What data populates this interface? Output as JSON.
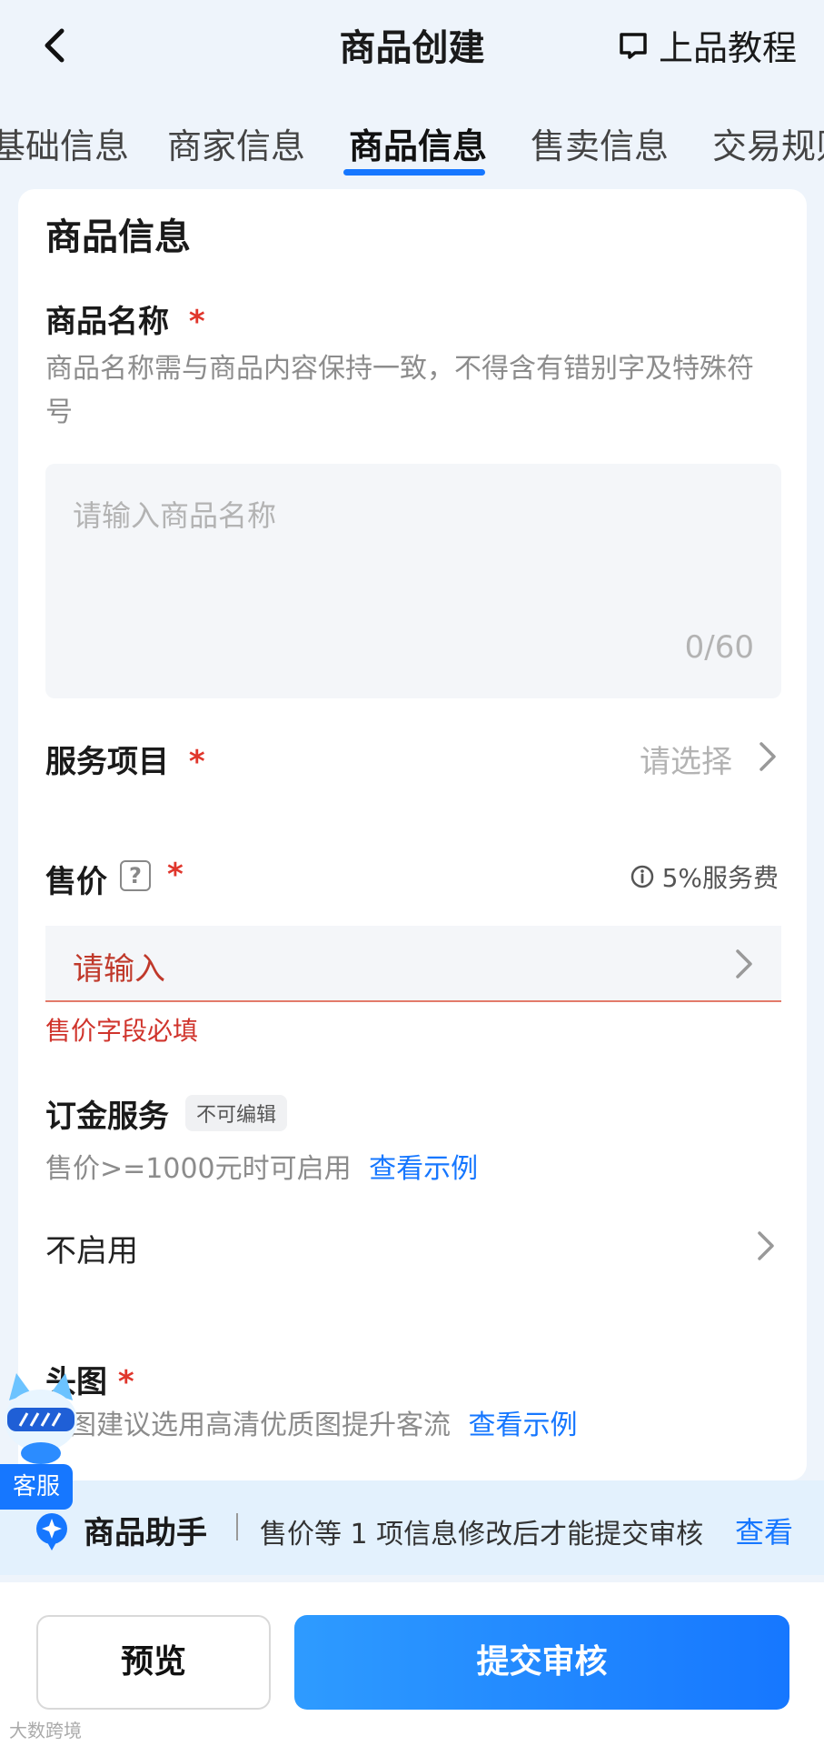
{
  "header": {
    "title": "商品创建",
    "tutorial_label": "上品教程"
  },
  "tabs": [
    {
      "label": "基础信息"
    },
    {
      "label": "商家信息"
    },
    {
      "label": "商品信息",
      "active": true
    },
    {
      "label": "售卖信息"
    },
    {
      "label": "交易规则"
    }
  ],
  "form": {
    "section_title": "商品信息",
    "product_name": {
      "label": "商品名称",
      "required_mark": "*",
      "hint": "商品名称需与商品内容保持一致，不得含有错别字及特殊符号",
      "placeholder": "请输入商品名称",
      "count": "0/60"
    },
    "service_item": {
      "label": "服务项目",
      "required_mark": "*",
      "value": "请选择"
    },
    "price": {
      "label": "售价",
      "help_icon": "?",
      "required_mark": "*",
      "fee_text": "5%服务费",
      "placeholder": "请输入",
      "error": "售价字段必填"
    },
    "deposit": {
      "label": "订金服务",
      "badge": "不可编辑",
      "hint": "售价>=1000元时可启用",
      "example_link": "查看示例",
      "value": "不启用"
    },
    "head_image": {
      "label": "头图",
      "required_mark": "*",
      "hint": "图建议选用高清优质图提升客流",
      "example_link": "查看示例"
    }
  },
  "assistant": {
    "title": "商品助手",
    "message": "售价等 1 项信息修改后才能提交审核",
    "link": "查看"
  },
  "customer_service": {
    "label": "客服"
  },
  "footer": {
    "preview_label": "预览",
    "submit_label": "提交审核"
  },
  "watermark": "大数跨境",
  "colors": {
    "accent": "#1677ff",
    "error": "#d0342c",
    "background": "#eef4fb"
  }
}
